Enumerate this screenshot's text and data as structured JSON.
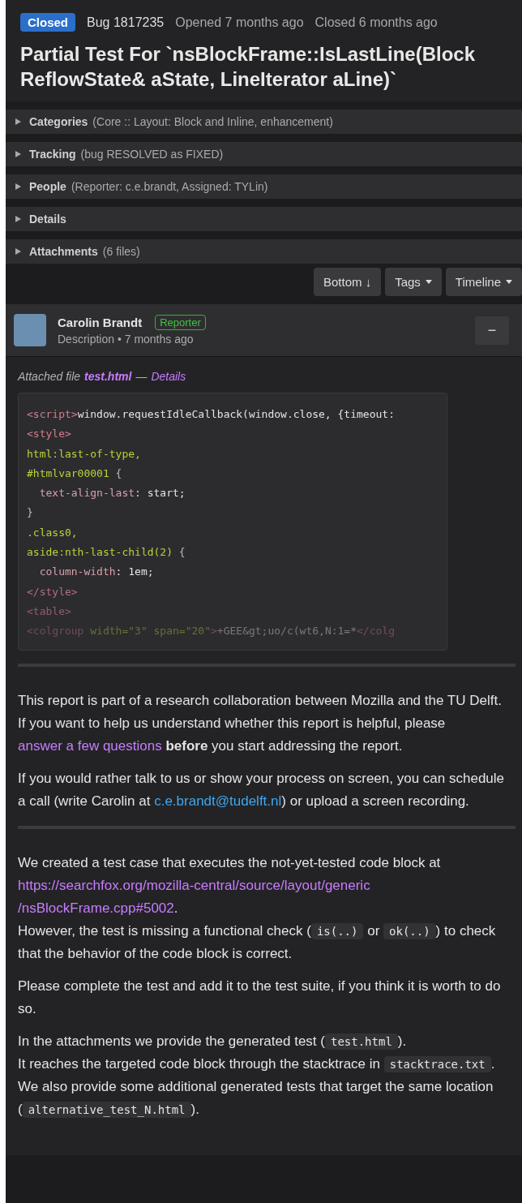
{
  "header": {
    "status": "Closed",
    "bug_id": "Bug 1817235",
    "opened": "Opened 7 months ago",
    "closed": "Closed 6 months ago",
    "title": "Partial Test For `nsBlockFrame::IsLastLine(Block ReflowState& aState, LineIterator aLine)`"
  },
  "sections": [
    {
      "label": "Categories",
      "summary": "(Core :: Layout: Block and Inline, enhancement)",
      "expanded": false
    },
    {
      "label": "Tracking",
      "summary": "(bug RESOLVED as FIXED)",
      "expanded": false
    },
    {
      "label": "People",
      "summary": "(Reporter: c.e.brandt, Assigned: TYLin)",
      "expanded": false
    },
    {
      "label": "Details",
      "expanded": false
    },
    {
      "label": "Attachments",
      "summary": "(6 files)",
      "expanded": false
    }
  ],
  "toolbar": [
    {
      "label": "Bottom ↓",
      "kind": "plain"
    },
    {
      "label": "Tags",
      "kind": "menu"
    },
    {
      "label": "Timeline",
      "kind": "menu"
    }
  ],
  "comment": {
    "author": "Carolin Brandt",
    "role": "Reporter",
    "meta": "Description • 7 months ago",
    "collapse": "−",
    "attachment": {
      "prefix": "Attached file",
      "file": "test.html",
      "dash": "—",
      "details": "Details"
    },
    "code": [
      [
        {
          "kind": "tag",
          "text": "<script>"
        },
        {
          "kind": "plain",
          "text": "window.requestIdleCallback(window.close, {timeout:"
        }
      ],
      [
        {
          "kind": "tag",
          "text": "<style>"
        }
      ],
      [
        {
          "kind": "selector",
          "text": "html:last-of-type,"
        }
      ],
      [
        {
          "kind": "selector",
          "text": "#htmlvar00001"
        },
        {
          "kind": "punct",
          "text": " {"
        }
      ],
      [
        {
          "kind": "property",
          "text": "  text-align-last"
        },
        {
          "kind": "plain",
          "text": ": start;"
        }
      ],
      [
        {
          "kind": "punct",
          "text": "}"
        }
      ],
      [
        {
          "kind": "selector",
          "text": ".class0,"
        }
      ],
      [
        {
          "kind": "selector",
          "text": "aside:nth-last-child(2)"
        },
        {
          "kind": "punct",
          "text": " {"
        }
      ],
      [
        {
          "kind": "property",
          "text": "  column-width"
        },
        {
          "kind": "plain",
          "text": ": 1em;"
        }
      ],
      [
        {
          "kind": "tag",
          "text": "</style>"
        }
      ],
      [
        {
          "kind": "tag",
          "text": "<table>"
        }
      ],
      [
        {
          "kind": "tag",
          "text": "<colgroup "
        },
        {
          "kind": "selector",
          "text": "width=\"3\" span=\"20\""
        },
        {
          "kind": "tag",
          "text": ">"
        },
        {
          "kind": "plain",
          "text": "+GEE&gt;uo/c(wt6,N:1=*"
        },
        {
          "kind": "tag",
          "text": "</colg"
        }
      ]
    ],
    "blocks": [
      {
        "paragraphs": [
          [
            [
              {
                "kind": "text",
                "text": "This report is part of a research collaboration between Mozilla and the TU Delft."
              }
            ],
            [
              {
                "kind": "text",
                "text": "If you want to help us understand whether this report is helpful, please "
              },
              {
                "kind": "link",
                "text": "answer a few questions"
              },
              {
                "kind": "bold",
                "text": " before"
              },
              {
                "kind": "text",
                "text": " you start addressing the report."
              }
            ]
          ],
          [
            [
              {
                "kind": "text",
                "text": "If you would rather talk to us or show your process on screen, you can schedule a call (write Carolin at "
              },
              {
                "kind": "email",
                "text": "c.e.brandt@tudelft.nl"
              },
              {
                "kind": "text",
                "text": ") or upload a screen recording."
              }
            ]
          ]
        ]
      },
      {
        "paragraphs": [
          [
            [
              {
                "kind": "text",
                "text": "We created a test case that executes the not-yet-tested code block at"
              }
            ],
            [
              {
                "kind": "link",
                "text": "https://searchfox.org/mozilla-central/source/layout/generic"
              }
            ],
            [
              {
                "kind": "link",
                "text": "/nsBlockFrame.cpp#5002"
              },
              {
                "kind": "text",
                "text": "."
              }
            ],
            [
              {
                "kind": "text",
                "text": "However, the test is missing a functional check ("
              },
              {
                "kind": "code",
                "text": "is(..)"
              },
              {
                "kind": "text",
                "text": " or "
              },
              {
                "kind": "code",
                "text": "ok(..)"
              },
              {
                "kind": "text",
                "text": ") to check that the behavior of the code block is correct."
              }
            ]
          ],
          [
            [
              {
                "kind": "text",
                "text": "Please complete the test and add it to the test suite, if you think it is worth to do so."
              }
            ]
          ],
          [
            [
              {
                "kind": "text",
                "text": "In the attachments we provide the generated test ("
              },
              {
                "kind": "code",
                "text": "test.html"
              },
              {
                "kind": "text",
                "text": ")."
              }
            ],
            [
              {
                "kind": "text",
                "text": "It reaches the targeted code block through the stacktrace in "
              },
              {
                "kind": "code",
                "text": "stacktrace.txt"
              },
              {
                "kind": "text",
                "text": "."
              }
            ],
            [
              {
                "kind": "text",
                "text": "We also provide some additional generated tests that target the same location ("
              },
              {
                "kind": "code",
                "text": "alternative_test_N.html"
              },
              {
                "kind": "text",
                "text": ")."
              }
            ]
          ]
        ]
      }
    ]
  }
}
